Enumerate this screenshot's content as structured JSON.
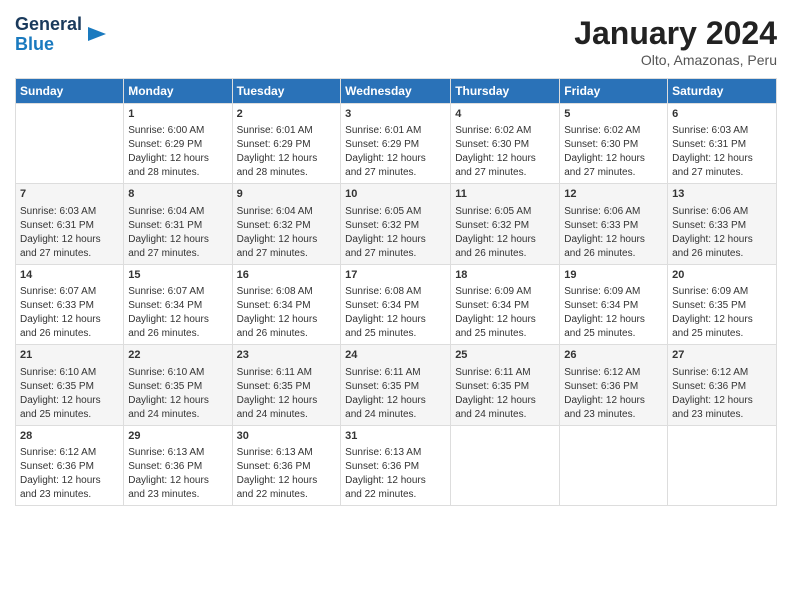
{
  "header": {
    "logo_line1": "General",
    "logo_line2": "Blue",
    "month_title": "January 2024",
    "location": "Olto, Amazonas, Peru"
  },
  "days_of_week": [
    "Sunday",
    "Monday",
    "Tuesday",
    "Wednesday",
    "Thursday",
    "Friday",
    "Saturday"
  ],
  "weeks": [
    [
      {
        "day": "",
        "info": ""
      },
      {
        "day": "1",
        "info": "Sunrise: 6:00 AM\nSunset: 6:29 PM\nDaylight: 12 hours\nand 28 minutes."
      },
      {
        "day": "2",
        "info": "Sunrise: 6:01 AM\nSunset: 6:29 PM\nDaylight: 12 hours\nand 28 minutes."
      },
      {
        "day": "3",
        "info": "Sunrise: 6:01 AM\nSunset: 6:29 PM\nDaylight: 12 hours\nand 27 minutes."
      },
      {
        "day": "4",
        "info": "Sunrise: 6:02 AM\nSunset: 6:30 PM\nDaylight: 12 hours\nand 27 minutes."
      },
      {
        "day": "5",
        "info": "Sunrise: 6:02 AM\nSunset: 6:30 PM\nDaylight: 12 hours\nand 27 minutes."
      },
      {
        "day": "6",
        "info": "Sunrise: 6:03 AM\nSunset: 6:31 PM\nDaylight: 12 hours\nand 27 minutes."
      }
    ],
    [
      {
        "day": "7",
        "info": "Sunrise: 6:03 AM\nSunset: 6:31 PM\nDaylight: 12 hours\nand 27 minutes."
      },
      {
        "day": "8",
        "info": "Sunrise: 6:04 AM\nSunset: 6:31 PM\nDaylight: 12 hours\nand 27 minutes."
      },
      {
        "day": "9",
        "info": "Sunrise: 6:04 AM\nSunset: 6:32 PM\nDaylight: 12 hours\nand 27 minutes."
      },
      {
        "day": "10",
        "info": "Sunrise: 6:05 AM\nSunset: 6:32 PM\nDaylight: 12 hours\nand 27 minutes."
      },
      {
        "day": "11",
        "info": "Sunrise: 6:05 AM\nSunset: 6:32 PM\nDaylight: 12 hours\nand 26 minutes."
      },
      {
        "day": "12",
        "info": "Sunrise: 6:06 AM\nSunset: 6:33 PM\nDaylight: 12 hours\nand 26 minutes."
      },
      {
        "day": "13",
        "info": "Sunrise: 6:06 AM\nSunset: 6:33 PM\nDaylight: 12 hours\nand 26 minutes."
      }
    ],
    [
      {
        "day": "14",
        "info": "Sunrise: 6:07 AM\nSunset: 6:33 PM\nDaylight: 12 hours\nand 26 minutes."
      },
      {
        "day": "15",
        "info": "Sunrise: 6:07 AM\nSunset: 6:34 PM\nDaylight: 12 hours\nand 26 minutes."
      },
      {
        "day": "16",
        "info": "Sunrise: 6:08 AM\nSunset: 6:34 PM\nDaylight: 12 hours\nand 26 minutes."
      },
      {
        "day": "17",
        "info": "Sunrise: 6:08 AM\nSunset: 6:34 PM\nDaylight: 12 hours\nand 25 minutes."
      },
      {
        "day": "18",
        "info": "Sunrise: 6:09 AM\nSunset: 6:34 PM\nDaylight: 12 hours\nand 25 minutes."
      },
      {
        "day": "19",
        "info": "Sunrise: 6:09 AM\nSunset: 6:34 PM\nDaylight: 12 hours\nand 25 minutes."
      },
      {
        "day": "20",
        "info": "Sunrise: 6:09 AM\nSunset: 6:35 PM\nDaylight: 12 hours\nand 25 minutes."
      }
    ],
    [
      {
        "day": "21",
        "info": "Sunrise: 6:10 AM\nSunset: 6:35 PM\nDaylight: 12 hours\nand 25 minutes."
      },
      {
        "day": "22",
        "info": "Sunrise: 6:10 AM\nSunset: 6:35 PM\nDaylight: 12 hours\nand 24 minutes."
      },
      {
        "day": "23",
        "info": "Sunrise: 6:11 AM\nSunset: 6:35 PM\nDaylight: 12 hours\nand 24 minutes."
      },
      {
        "day": "24",
        "info": "Sunrise: 6:11 AM\nSunset: 6:35 PM\nDaylight: 12 hours\nand 24 minutes."
      },
      {
        "day": "25",
        "info": "Sunrise: 6:11 AM\nSunset: 6:35 PM\nDaylight: 12 hours\nand 24 minutes."
      },
      {
        "day": "26",
        "info": "Sunrise: 6:12 AM\nSunset: 6:36 PM\nDaylight: 12 hours\nand 23 minutes."
      },
      {
        "day": "27",
        "info": "Sunrise: 6:12 AM\nSunset: 6:36 PM\nDaylight: 12 hours\nand 23 minutes."
      }
    ],
    [
      {
        "day": "28",
        "info": "Sunrise: 6:12 AM\nSunset: 6:36 PM\nDaylight: 12 hours\nand 23 minutes."
      },
      {
        "day": "29",
        "info": "Sunrise: 6:13 AM\nSunset: 6:36 PM\nDaylight: 12 hours\nand 23 minutes."
      },
      {
        "day": "30",
        "info": "Sunrise: 6:13 AM\nSunset: 6:36 PM\nDaylight: 12 hours\nand 22 minutes."
      },
      {
        "day": "31",
        "info": "Sunrise: 6:13 AM\nSunset: 6:36 PM\nDaylight: 12 hours\nand 22 minutes."
      },
      {
        "day": "",
        "info": ""
      },
      {
        "day": "",
        "info": ""
      },
      {
        "day": "",
        "info": ""
      }
    ]
  ]
}
